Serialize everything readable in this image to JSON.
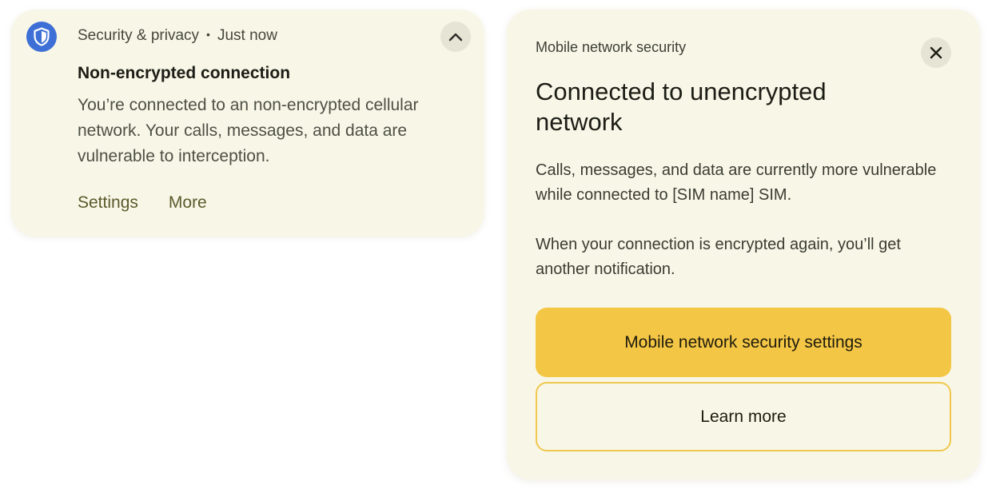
{
  "notification": {
    "app_icon": "shield-icon",
    "app_name": "Security & privacy",
    "separator": "•",
    "timestamp": "Just now",
    "collapse_icon": "chevron-up-icon",
    "title": "Non-encrypted connection",
    "body": "You’re connected to an non-encrypted cellular network. Your calls, messages, and data are vulnerable to interception.",
    "actions": {
      "settings": "Settings",
      "more": "More"
    }
  },
  "dialog": {
    "overline": "Mobile network security",
    "close_icon": "close-icon",
    "headline": "Connected to unencrypted network",
    "paragraph_1": "Calls, messages, and data are currently more vulnerable while connected to [SIM name] SIM.",
    "paragraph_2": "When your connection is encrypted again, you’ll get another notification.",
    "primary_button": "Mobile network security settings",
    "secondary_button": "Learn more"
  },
  "colors": {
    "card_background": "#f8f6e6",
    "icon_blue": "#3d6fd6",
    "primary_button": "#f4c646",
    "outline_border": "#f0c84f",
    "action_text": "#5b5a2c"
  }
}
